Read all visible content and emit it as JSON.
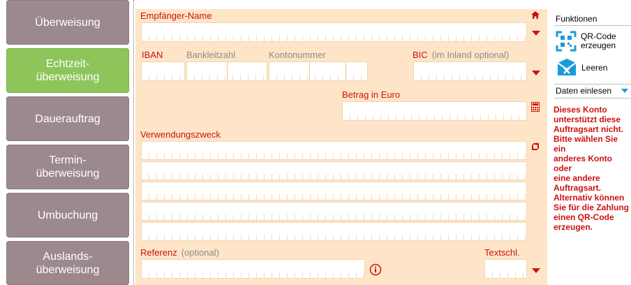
{
  "nav": {
    "items": [
      {
        "label": "Überweisung"
      },
      {
        "label": "Echtzeit-\nüberweisung"
      },
      {
        "label": "Dauerauftrag"
      },
      {
        "label": "Termin-\nüberweisung"
      },
      {
        "label": "Umbuchung"
      },
      {
        "label": "Auslands-\nüberweisung"
      }
    ],
    "active_index": 1,
    "active_color": "#8dc55b",
    "inactive_color": "#9c898d"
  },
  "form": {
    "recipient_label": "Empfänger-Name",
    "iban_label": "IBAN",
    "blz_label": "Bankleitzahl",
    "account_label": "Kontonummer",
    "bic_label": "BIC",
    "bic_optional": "(im Inland optional)",
    "amount_label": "Betrag in Euro",
    "purpose_label": "Verwendungszweck",
    "reference_label": "Referenz",
    "reference_optional": "(optional)",
    "textkey_label": "Textschl.",
    "background_color": "#fee5c7",
    "label_color": "#cc1111"
  },
  "icons": {
    "home": "home-icon",
    "calculator": "calculator-icon",
    "swap": "swap-icon",
    "info": "info-icon",
    "dropdown": "triangle-down-icon",
    "qr": "qr-code-icon",
    "clear": "clear-envelope-icon"
  },
  "sidebar": {
    "title": "Funktionen",
    "qr_label": "QR-Code\nerzeugen",
    "clear_label": "Leeren",
    "read_data_label": "Daten einlesen",
    "warning": "Dieses Konto\nunterstützt diese\nAuftragsart nicht.\nBitte wählen Sie ein\nanderes Konto oder\neine andere\nAuftragsart.\nAlternativ können\nSie für die Zahlung\neinen QR-Code\nerzeugen.",
    "accent_color": "#1a9bd7"
  }
}
